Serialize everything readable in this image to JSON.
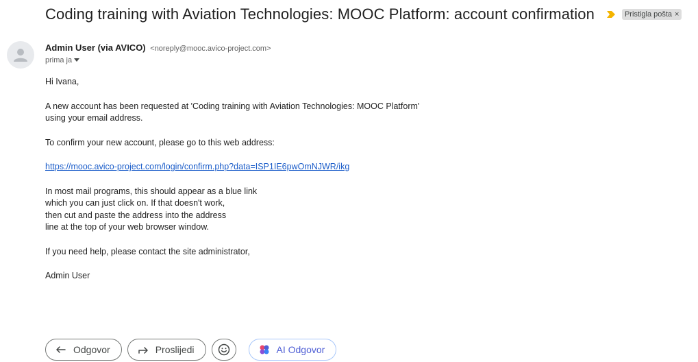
{
  "email": {
    "subject": "Coding training with Aviation Technologies: MOOC Platform: account confirmation",
    "label": "Pristigla pošta",
    "label_close": "×",
    "sender_name": "Admin User (via AVICO)",
    "sender_email": "<noreply@mooc.avico-project.com>",
    "recipient": "prima ja",
    "body": {
      "greeting": "Hi Ivana,",
      "para1_line1": "A new account has been requested at 'Coding training with Aviation Technologies: MOOC Platform'",
      "para1_line2": "using your email address.",
      "para2": "To confirm your new account, please go to this web address:",
      "link": "https://mooc.avico-project.com/login/confirm.php?data=ISP1IE6pwOmNJWR/ikg",
      "para3_line1": "In most mail programs, this should appear as a blue link",
      "para3_line2": "which you can just click on. If that doesn't work,",
      "para3_line3": "then cut and paste the address into the address",
      "para3_line4": "line at the top of your web browser window.",
      "para4": "If you need help, please contact the site administrator,",
      "signature": "Admin User"
    }
  },
  "actions": {
    "reply": "Odgovor",
    "forward": "Proslijedi",
    "ai_reply": "AI Odgovor"
  },
  "icons": {
    "importance": "importance-marker-icon",
    "avatar": "person-avatar-icon",
    "dropdown": "caret-down-icon",
    "reply": "reply-arrow-icon",
    "forward": "forward-arrow-icon",
    "emoji": "emoji-smile-icon",
    "ai": "ai-sparkle-icon"
  },
  "colors": {
    "importance": "#f4b400",
    "link": "#1a5cc9",
    "ai_accent": "#4f5fd5",
    "label_chip": "#dddddd"
  }
}
